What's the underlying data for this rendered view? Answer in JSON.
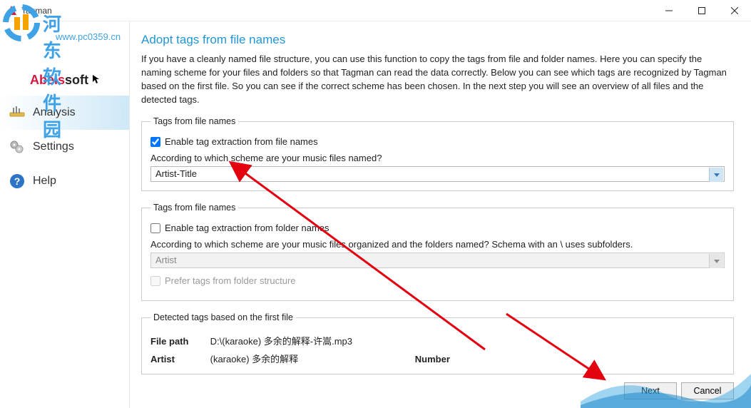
{
  "window": {
    "title": "Tagman"
  },
  "watermark": {
    "line1": "河东软件园",
    "line2": "www.pc0359.cn"
  },
  "brand": {
    "name_prefix": "Abels",
    "name_suffix": "soft"
  },
  "sidebar": {
    "items": [
      {
        "id": "analysis",
        "label": "Analysis",
        "active": true
      },
      {
        "id": "settings",
        "label": "Settings",
        "active": false
      },
      {
        "id": "help",
        "label": "Help",
        "active": false
      }
    ]
  },
  "page": {
    "title": "Adopt tags from file names",
    "intro": "If you have a cleanly named file structure, you can use this function to copy the tags from file and folder names. Here you can specify the naming scheme for your files and folders so that Tagman can read the data correctly. Below you can see which tags are recognized by Tagman based on the first file. So you can see if the correct scheme has been chosen. In the next step you will see an overview of all files and the detected tags."
  },
  "group1": {
    "legend": "Tags from file names",
    "checkbox_label": "Enable tag extraction from file names",
    "checkbox_checked": true,
    "question": "According to which scheme are your music files named?",
    "select_value": "Artist-Title"
  },
  "group2": {
    "legend": "Tags from file names",
    "checkbox_label": "Enable tag extraction from folder names",
    "checkbox_checked": false,
    "question": "According to which scheme are your music files organized and the folders named? Schema with an \\ uses subfolders.",
    "select_value": "Artist",
    "prefer_label": "Prefer tags from folder structure",
    "prefer_checked": false
  },
  "group3": {
    "legend": "Detected tags based on the first file",
    "filepath_label": "File path",
    "filepath_value": "D:\\(karaoke) 多余的解释-许嵩.mp3",
    "artist_label": "Artist",
    "artist_value": "(karaoke) 多余的解释",
    "number_label": "Number"
  },
  "footer": {
    "next": "Next",
    "cancel": "Cancel"
  }
}
